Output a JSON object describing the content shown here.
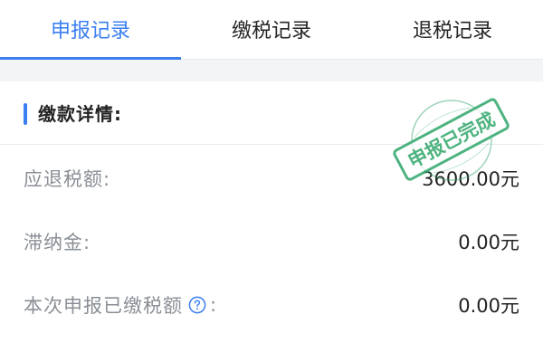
{
  "tabs": [
    {
      "label": "申报记录",
      "active": true
    },
    {
      "label": "缴税记录",
      "active": false
    },
    {
      "label": "退税记录",
      "active": false
    }
  ],
  "details": {
    "title": "缴款详情:",
    "rows": [
      {
        "label": "应退税额:",
        "value": "3600.00元"
      },
      {
        "label": "滞纳金:",
        "value": "0.00元"
      },
      {
        "label": "本次申报已缴税额",
        "suffix": ":",
        "value": "0.00元",
        "has_help": true
      }
    ]
  },
  "stamp": {
    "text": "申报已完成",
    "color": "#2fa66a"
  },
  "colors": {
    "accent": "#3b7ff2",
    "label": "#8a8f96",
    "value": "#222222",
    "divider_bg": "#f3f4f6"
  },
  "icons": {
    "help": "question-circle-icon"
  }
}
